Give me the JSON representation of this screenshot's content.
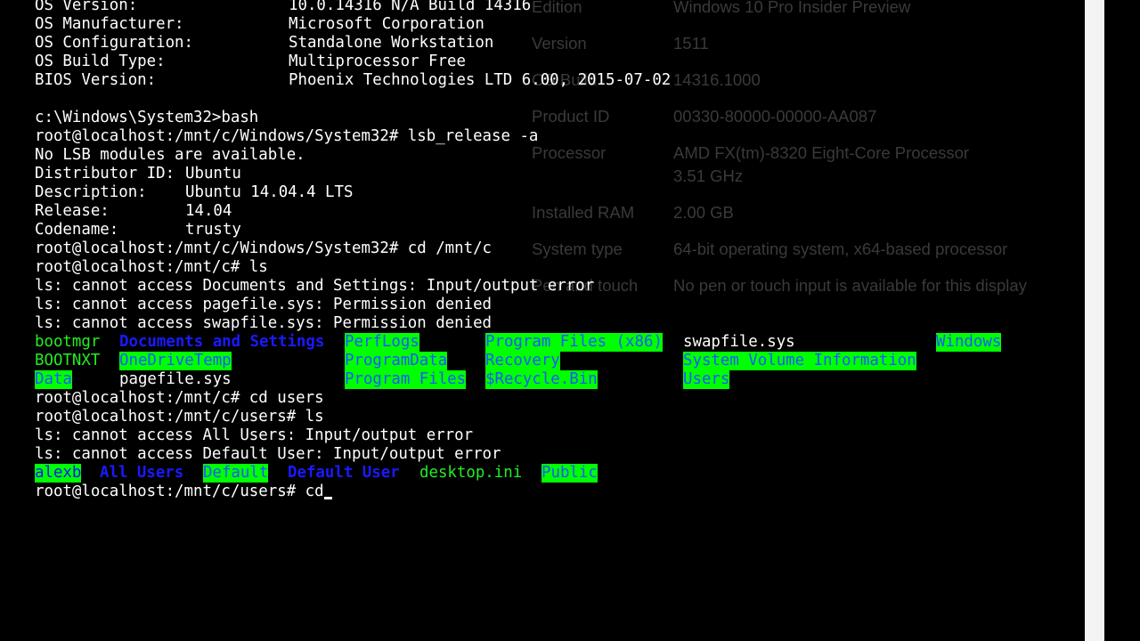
{
  "system_info": {
    "rows": [
      {
        "label": "Edition",
        "value": "Windows 10 Pro Insider Preview"
      },
      {
        "label": "Version",
        "value": "1511"
      },
      {
        "label": "OS Build",
        "value": "14316.1000"
      },
      {
        "label": "Product ID",
        "value": "00330-80000-00000-AA087"
      },
      {
        "label": "Processor",
        "value": "AMD FX(tm)-8320 Eight-Core Processor",
        "value2": "3.51 GHz"
      },
      {
        "label": "Installed RAM",
        "value": "2.00 GB"
      },
      {
        "label": "System type",
        "value": "64-bit operating system, x64-based processor"
      },
      {
        "label": "Pen and touch",
        "value": "No pen or touch input is available for this display"
      }
    ]
  },
  "terminal": {
    "os_version": {
      "label": "OS Version:",
      "value": "10.0.14316 N/A Build 14316"
    },
    "os_manufacturer": {
      "label": "OS Manufacturer:",
      "value": "Microsoft Corporation"
    },
    "os_configuration": {
      "label": "OS Configuration:",
      "value": "Standalone Workstation"
    },
    "os_build_type": {
      "label": "OS Build Type:",
      "value": "Multiprocessor Free"
    },
    "bios_version": {
      "label": "BIOS Version:",
      "value": "Phoenix Technologies LTD 6.00, 2015-07-02"
    },
    "cmd_bash": "c:\\Windows\\System32>bash",
    "cmd_lsb": "root@localhost:/mnt/c/Windows/System32# lsb_release -a",
    "lsb_nomod": "No LSB modules are available.",
    "distributor": {
      "label": "Distributor ID:",
      "value": "Ubuntu"
    },
    "description": {
      "label": "Description:",
      "value": "Ubuntu 14.04.4 LTS"
    },
    "release": {
      "label": "Release:",
      "value": "14.04"
    },
    "codename": {
      "label": "Codename:",
      "value": "trusty"
    },
    "cmd_cd_mntc": "root@localhost:/mnt/c/Windows/System32# cd /mnt/c",
    "cmd_ls1": "root@localhost:/mnt/c# ls",
    "err1": "ls: cannot access Documents and Settings: Input/output error",
    "err2": "ls: cannot access pagefile.sys: Permission denied",
    "err3": "ls: cannot access swapfile.sys: Permission denied",
    "listing_row1": [
      "bootmgr",
      "Documents and Settings",
      "PerfLogs",
      "Program Files (x86)",
      "swapfile.sys",
      "Windows"
    ],
    "listing_row2": [
      "BOOTNXT",
      "OneDriveTemp",
      "ProgramData",
      "Recovery",
      "System Volume Information"
    ],
    "listing_row3": [
      "Data",
      "pagefile.sys",
      "Program Files",
      "$Recycle.Bin",
      "Users"
    ],
    "cmd_cd_users": "root@localhost:/mnt/c# cd users",
    "cmd_ls2": "root@localhost:/mnt/c/users# ls",
    "err4": "ls: cannot access All Users: Input/output error",
    "err5": "ls: cannot access Default User: Input/output error",
    "users_listing": [
      "alexb",
      "All Users",
      "Default",
      "Default User",
      "desktop.ini",
      "Public"
    ],
    "prompt_current": "root@localhost:/mnt/c/users# cd"
  }
}
